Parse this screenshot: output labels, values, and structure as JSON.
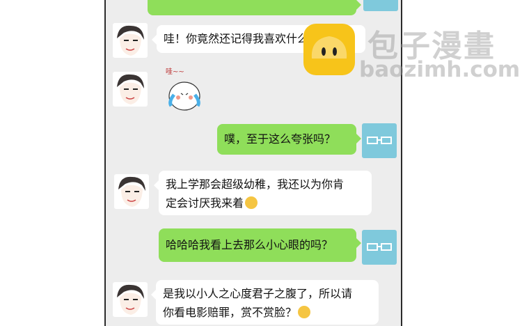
{
  "chat": {
    "messages": [
      {
        "side": "right",
        "text": "",
        "partial": true
      },
      {
        "side": "left",
        "text": "哇！你竟然还记得我喜欢什么！"
      },
      {
        "side": "left",
        "sticker": true,
        "sticker_text": "哇~~"
      },
      {
        "side": "right",
        "text": "噗，至于这么夸张吗？"
      },
      {
        "side": "left",
        "text": "我上学那会超级幼稚，我还以为你肯\n定会讨厌我来着",
        "emoji": "worried-face"
      },
      {
        "side": "right",
        "text": "哈哈哈我看上去那么小心眼的吗？"
      },
      {
        "side": "left",
        "text": "是我以小人之心度君子之腹了，所以请\n你看电影赔罪，赏不赏脸？",
        "emoji": "grinning-face"
      }
    ]
  },
  "watermark": {
    "brand": "包子漫畫",
    "url": "baozimh.com"
  },
  "colors": {
    "chat_bg": "#ededed",
    "bubble_right": "#8fde5a",
    "bubble_left": "#ffffff",
    "my_avatar": "#7fc9dc",
    "watermark_logo": "#f7c41a"
  }
}
